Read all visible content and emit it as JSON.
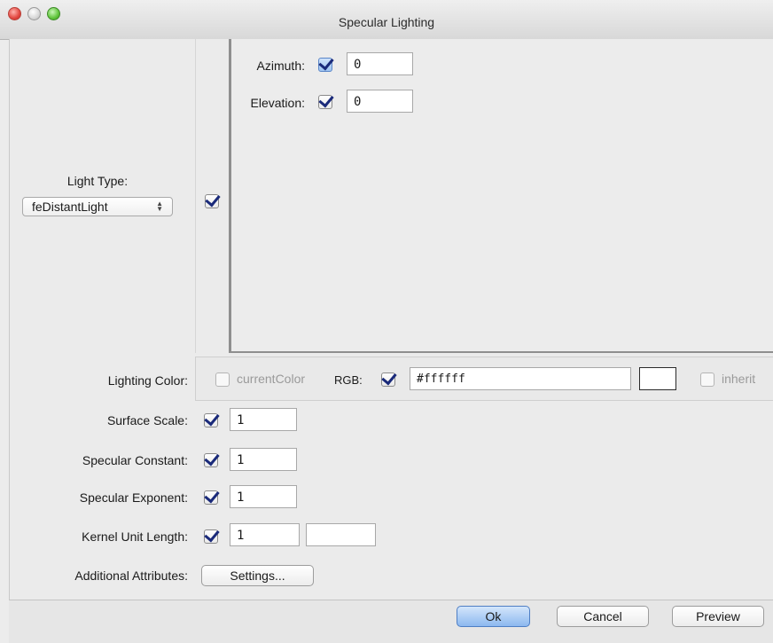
{
  "window": {
    "title": "Specular Lighting"
  },
  "light_type": {
    "label": "Light Type:",
    "selected": "feDistantLight"
  },
  "distant_light": {
    "azimuth_label": "Azimuth:",
    "azimuth_value": "0",
    "elevation_label": "Elevation:",
    "elevation_value": "0"
  },
  "lighting_color": {
    "label": "Lighting Color:",
    "current_color_label": "currentColor",
    "rgb_label": "RGB:",
    "rgb_value": "#ffffff",
    "swatch_color": "#ffffff",
    "inherit_label": "inherit"
  },
  "surface_scale": {
    "label": "Surface Scale:",
    "value": "1"
  },
  "specular_constant": {
    "label": "Specular Constant:",
    "value": "1"
  },
  "specular_exponent": {
    "label": "Specular Exponent:",
    "value": "1"
  },
  "kernel_unit_length": {
    "label": "Kernel Unit Length:",
    "value1": "1",
    "value2": ""
  },
  "additional_attributes": {
    "label": "Additional Attributes:",
    "button": "Settings..."
  },
  "buttons": {
    "ok": "Ok",
    "cancel": "Cancel",
    "preview": "Preview"
  },
  "colors": {
    "accent": "#8cb8ef",
    "check_mark": "#1a2a7a"
  }
}
